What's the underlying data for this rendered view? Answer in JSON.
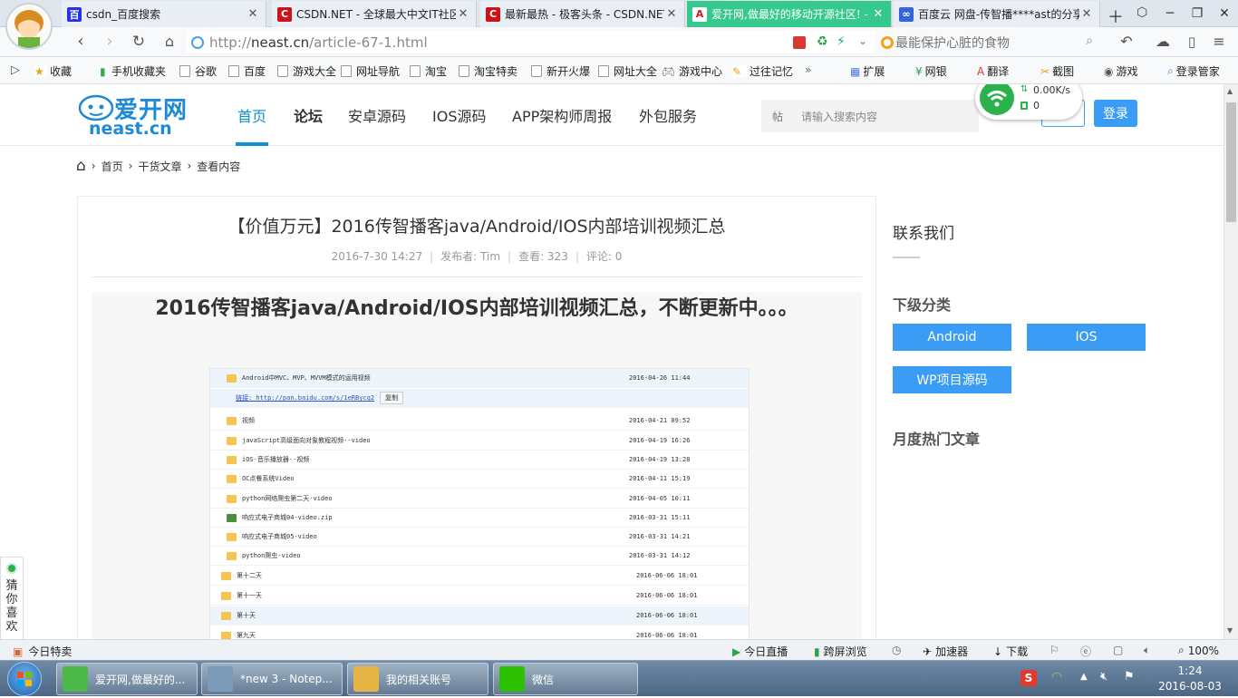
{
  "tabs": [
    {
      "title": "csdn_百度搜索",
      "favicon": "百",
      "color": "#2932e1",
      "active": false
    },
    {
      "title": "CSDN.NET - 全球最大中文IT社区",
      "favicon": "C",
      "color": "#c9141c",
      "active": false
    },
    {
      "title": "最新最热 - 极客头条 - CSDN.NET",
      "favicon": "C",
      "color": "#c9141c",
      "active": false
    },
    {
      "title": "爱开网,做最好的移动开源社区! -",
      "favicon": "A",
      "color": "#d4171c",
      "active": true
    },
    {
      "title": "百度云 网盘-传智播****ast的分享",
      "favicon": "∞",
      "color": "#3464d5",
      "active": false
    }
  ],
  "address": {
    "protocol": "http://",
    "host": "neast.cn",
    "path": "/article-67-1.html"
  },
  "browser_search": {
    "placeholder": "最能保护心脏的食物"
  },
  "bookmarks": [
    "收藏",
    "手机收藏夹",
    "谷歌",
    "百度",
    "游戏大全",
    "网址导航",
    "淘宝",
    "淘宝特卖",
    "新开火爆",
    "网址大全",
    "游戏中心",
    "过往记忆"
  ],
  "toolbar_right": [
    "扩展",
    "网银",
    "翻译",
    "截图",
    "游戏",
    "登录管家"
  ],
  "network": {
    "speed": "0.00K/s",
    "count": "0"
  },
  "site": {
    "logo_text": "爱开网",
    "logo_sub": "neast.cn",
    "menu": [
      "首页",
      "论坛",
      "安卓源码",
      "IOS源码",
      "APP架构师周报",
      "外包服务"
    ],
    "search_prefix": "帖",
    "search_placeholder": "请输入搜索内容",
    "login": "登录"
  },
  "breadcrumb": [
    "首页",
    "干货文章",
    "查看内容"
  ],
  "article": {
    "title": "【价值万元】2016传智播客java/Android/IOS内部培训视频汇总",
    "date": "2016-7-30 14:27",
    "author": "发布者: Tim",
    "views": "查看: 323",
    "comments": "评论: 0",
    "heading": "2016传智播客java/Android/IOS内部培训视频汇总，不断更新中。。。"
  },
  "pan_rows": [
    {
      "name": "Android中MVC、MVP、MVVM模式的运用视频",
      "date": "2016-04-26 11:44",
      "highlight": true
    },
    {
      "name": "链接: http://pan.baidu.com/s/1eRBycq2",
      "date": "",
      "highlight": true,
      "link": true,
      "copy": "复制"
    },
    {
      "name": "视频",
      "date": "2016-04-21 09:52"
    },
    {
      "name": "javaScript高级面向对象教程视频--video",
      "date": "2016-04-19 16:26"
    },
    {
      "name": "iOS-音乐播放器--视频",
      "date": "2016-04-19 13:28"
    },
    {
      "name": "OC点餐系统Video",
      "date": "2016-04-11 15:19"
    },
    {
      "name": "python网络爬虫第二天-video",
      "date": "2016-04-05 10:11"
    },
    {
      "name": "响应式电子商城04-video.zip",
      "date": "2016-03-31 15:11",
      "zip": true
    },
    {
      "name": "响应式电子商城05-video",
      "date": "2016-03-31 14:21"
    },
    {
      "name": "python爬虫-video",
      "date": "2016-03-31 14:12"
    },
    {
      "name": "第十二天",
      "date": "2016-06-06 18:01"
    },
    {
      "name": "第十一天",
      "date": "2016-06-06 18:01"
    },
    {
      "name": "第十天",
      "date": "2016-06-06 18:01",
      "highlight": true
    },
    {
      "name": "第九天",
      "date": "2016-06-06 18:01"
    }
  ],
  "sidebar": {
    "contact": "联系我们",
    "subcats_title": "下级分类",
    "subcats": [
      "Android",
      "IOS",
      "WP项目源码"
    ],
    "hot": "月度热门文章"
  },
  "guess": "猜你喜欢",
  "statusbar": {
    "left": "今日特卖",
    "live": "今日直播",
    "cross": "跨屏浏览",
    "accel": "加速器",
    "download": "下载",
    "zoom": "100%"
  },
  "taskbar": [
    {
      "label": "爱开网,做最好的...",
      "color": "#4cb84a"
    },
    {
      "label": "*new  3 - Notep...",
      "color": "#7c9bb8"
    },
    {
      "label": "我的相关账号",
      "color": "#e6b545"
    },
    {
      "label": "微信",
      "color": "#2dc100"
    }
  ],
  "clock": {
    "time": "1:24",
    "date": "2016-08-03"
  }
}
